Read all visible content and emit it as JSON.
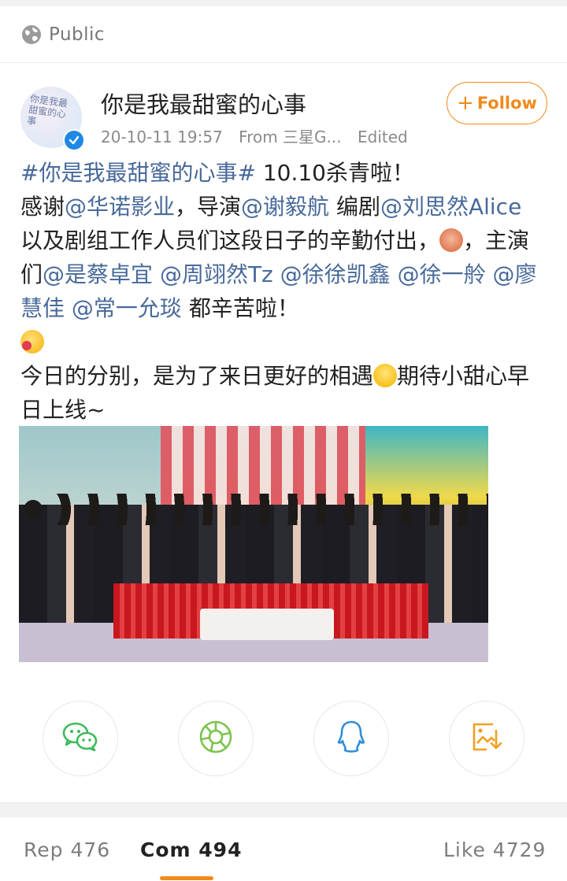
{
  "visibility": {
    "label": "Public",
    "icon": "globe-icon"
  },
  "author": {
    "name": "你是我最甜蜜的心事",
    "avatar_text": "你是我最甜蜜的心事",
    "verified": true,
    "time": "20-10-11 19:57",
    "source": "From 三星G...",
    "edited": "Edited"
  },
  "follow": {
    "plus": "+",
    "label": "Follow"
  },
  "post": {
    "hashtag": "#你是我最甜蜜的心事#",
    "t1": " 10.10杀青啦！",
    "t2": "感谢",
    "m_huanuo": "@华诺影业",
    "t3": "，导演",
    "m_director": "@谢毅航",
    "t4": " 编剧",
    "m_writer": "@刘思然Alice",
    "t5": " 以及剧组工作人员们这段日子的辛勤付出，",
    "t6": "，主演们",
    "m_cai": "@是蔡卓宜",
    "m_zhou": "@周翊然Tz",
    "m_xukaixin": "@徐徐凯鑫",
    "m_xuyiling": "@徐一舲",
    "m_liao": "@廖慧佳",
    "m_chang": "@常一允琰",
    "t7": " 都辛苦啦！",
    "t8": "今日的分别，是为了来日更好的相遇",
    "t9": "期待小甜心早日上线~",
    "space": " "
  },
  "share": [
    {
      "name": "wechat",
      "icon": "wechat-icon",
      "color": "#3cba5c"
    },
    {
      "name": "moments",
      "icon": "moments-icon",
      "color": "#7cc34d"
    },
    {
      "name": "qq",
      "icon": "qq-icon",
      "color": "#2f8ed8"
    },
    {
      "name": "save",
      "icon": "save-image-icon",
      "color": "#f0a020"
    }
  ],
  "stats": {
    "reposts": "Rep 476",
    "comments": "Com 494",
    "likes": "Like 4729",
    "active_tab": "comments"
  },
  "colors": {
    "accent": "#f08a1c",
    "link": "#47699a",
    "verified": "#1e88e5"
  }
}
